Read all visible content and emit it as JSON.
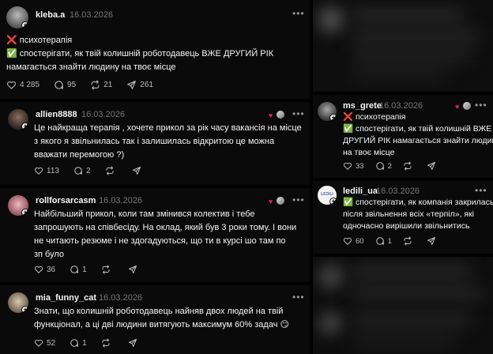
{
  "posts": [
    {
      "username": "kleba.a",
      "date": "16.03.2026",
      "lines": [
        "❌ психотерапія",
        "✅ спостерігати, як твій колишній роботодавець ВЖЕ ДРУГИЙ РІК",
        "намагається знайти людину на твоє місце"
      ],
      "likes": "4 285",
      "comments": "95",
      "reposts": "21",
      "shares": "261"
    },
    {
      "username": "allien8888",
      "date": "16.03.2026",
      "lines": [
        "Це найкраща терапія , хочете прикол за рік часу вакансія на місце",
        "з якого я звільнилась так і залишилась відкритою це можна",
        "вважати перемогою ?)"
      ],
      "likes": "113",
      "comments": "2"
    },
    {
      "username": "rollforsarcasm",
      "date": "16.03.2026",
      "lines": [
        "Найбільший прикол, коли там змінився колектив і тебе",
        "запрошують на співбесіду. На оклад, який був 3 роки тому. І вони",
        "не читають резюме і не здогадуються, що ти в курсі шо там по",
        "зп було"
      ],
      "likes": "36",
      "comments": "1"
    },
    {
      "username": "mia_funny_cat",
      "date": "16.03.2026",
      "lines": [
        "Знати, що колишній роботодавець найняв двох людей на твій",
        "функціонал, а ці дві людини витягують максимум 60% задач 😏"
      ],
      "likes": "52",
      "comments": "1"
    },
    {
      "username": "ms_grete",
      "date": "16.03.2026",
      "lines": [
        "❌ психотерапія",
        "✅ спостерігати, як твій колишній ВЖЕ",
        "ДРУГИЙ РІК намагається знайти людину",
        "на твоє місце"
      ],
      "likes": "33",
      "comments": "2"
    },
    {
      "username": "ledili_ua",
      "date": "16.03.2026",
      "avatar_text": "LEDILI",
      "lines": [
        "✅ спостерігати, як компанія закрилась",
        "після звільнення всіх «терпіл», які",
        "одночасно вирішили звільнитись"
      ],
      "likes": "60",
      "comments": "1"
    }
  ],
  "colors": {
    "background": "#0a0a0a",
    "text": "#f3f5f7",
    "muted": "#777777",
    "heart": "#e0245e"
  },
  "icons": [
    "heart-icon",
    "comment-icon",
    "repost-icon",
    "share-icon",
    "more-icon",
    "follow-plus-icon"
  ]
}
